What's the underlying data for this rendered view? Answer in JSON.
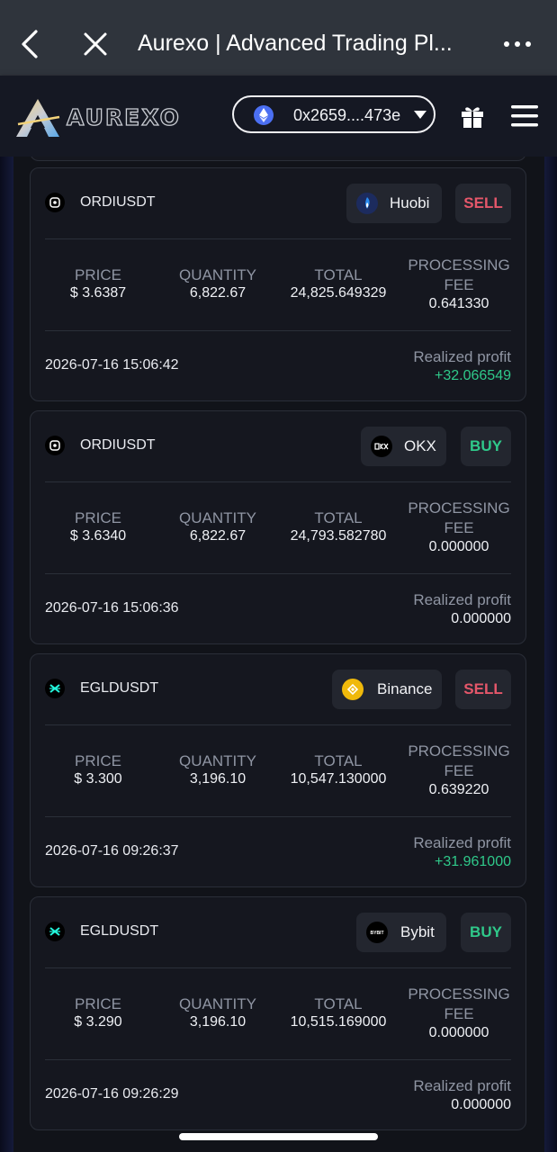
{
  "browser": {
    "title": "Aurexo | Advanced Trading Pl..."
  },
  "header": {
    "logo_text": "AUREXO",
    "wallet_address": "0x2659....473e"
  },
  "labels": {
    "price": "PRICE",
    "quantity": "QUANTITY",
    "total": "TOTAL",
    "fee_line1": "PROCESSING",
    "fee_line2": "FEE",
    "realized_profit": "Realized profit"
  },
  "trades": [
    {
      "pair": "ORDIUSDT",
      "coin_icon": "ordi-icon",
      "exchange": "Huobi",
      "exchange_icon": "huobi-icon",
      "side": "SELL",
      "price": "$ 3.6387",
      "quantity": "6,822.67",
      "total": "24,825.649329",
      "fee": "0.641330",
      "datetime": "2026-07-16 15:06:42",
      "profit": "+32.066549",
      "profit_color": "#2fc98a"
    },
    {
      "pair": "ORDIUSDT",
      "coin_icon": "ordi-icon",
      "exchange": "OKX",
      "exchange_icon": "okx-icon",
      "side": "BUY",
      "price": "$ 3.6340",
      "quantity": "6,822.67",
      "total": "24,793.582780",
      "fee": "0.000000",
      "datetime": "2026-07-16 15:06:36",
      "profit": "0.000000",
      "profit_color": "#eef0f4"
    },
    {
      "pair": "EGLDUSDT",
      "coin_icon": "egld-icon",
      "exchange": "Binance",
      "exchange_icon": "binance-icon",
      "side": "SELL",
      "price": "$ 3.300",
      "quantity": "3,196.10",
      "total": "10,547.130000",
      "fee": "0.639220",
      "datetime": "2026-07-16 09:26:37",
      "profit": "+31.961000",
      "profit_color": "#2fc98a"
    },
    {
      "pair": "EGLDUSDT",
      "coin_icon": "egld-icon",
      "exchange": "Bybit",
      "exchange_icon": "bybit-icon",
      "side": "BUY",
      "price": "$ 3.290",
      "quantity": "3,196.10",
      "total": "10,515.169000",
      "fee": "0.000000",
      "datetime": "2026-07-16 09:26:29",
      "profit": "0.000000",
      "profit_color": "#eef0f4"
    }
  ],
  "colors": {
    "sell": "#e5576a",
    "buy": "#2fc98a",
    "background": "#111319",
    "card": "#15171f"
  }
}
